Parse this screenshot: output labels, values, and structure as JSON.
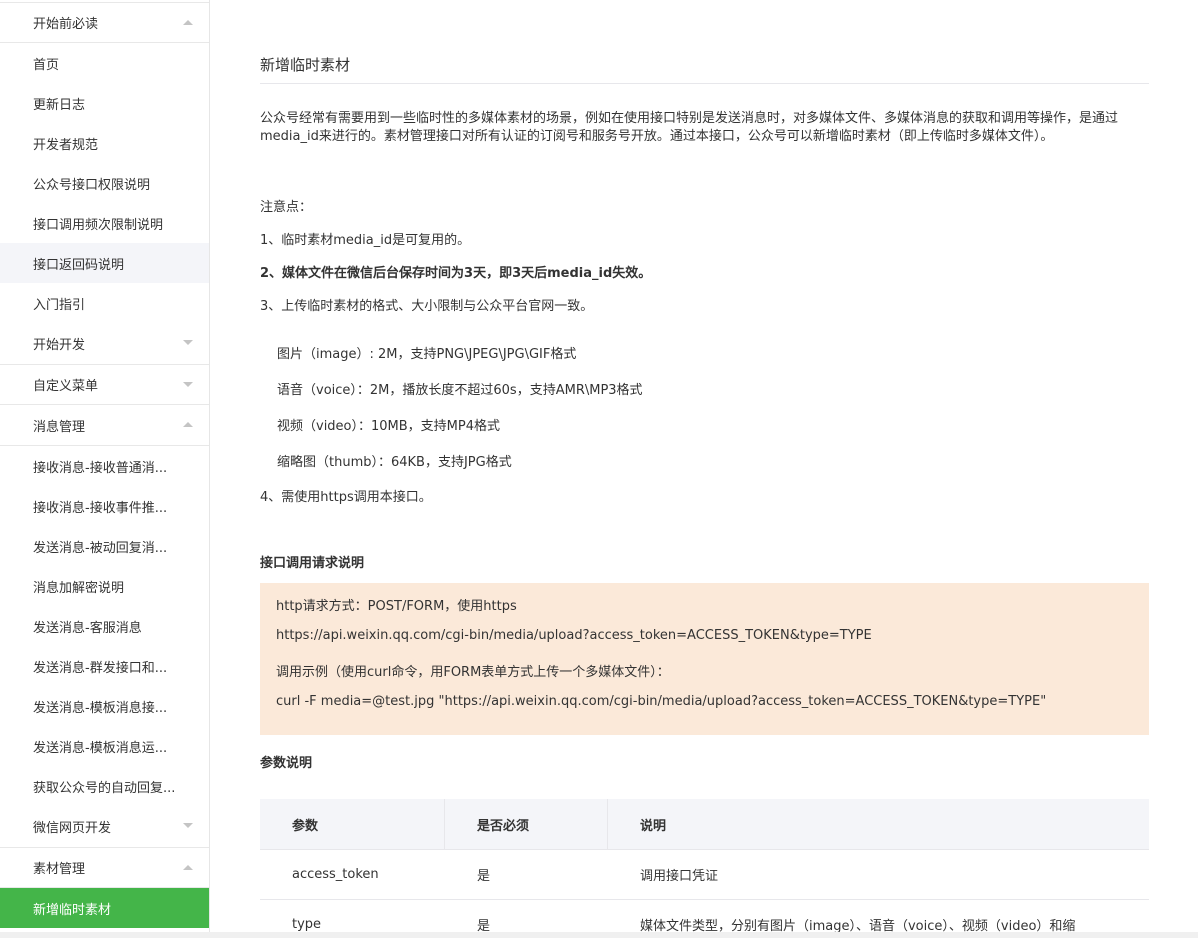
{
  "sidebar": {
    "items": [
      {
        "label": "开始前必读",
        "type": "group",
        "caret": "up"
      },
      {
        "label": "首页"
      },
      {
        "label": "更新日志"
      },
      {
        "label": "开发者规范"
      },
      {
        "label": "公众号接口权限说明"
      },
      {
        "label": "接口调用频次限制说明"
      },
      {
        "label": "接口返回码说明",
        "state": "hover"
      },
      {
        "label": "入门指引"
      },
      {
        "label": "开始开发",
        "caret": "down"
      },
      {
        "label": "自定义菜单",
        "type": "group",
        "caret": "down"
      },
      {
        "label": "消息管理",
        "type": "group",
        "caret": "up"
      },
      {
        "label": "接收消息-接收普通消..."
      },
      {
        "label": "接收消息-接收事件推..."
      },
      {
        "label": "发送消息-被动回复消..."
      },
      {
        "label": "消息加解密说明"
      },
      {
        "label": "发送消息-客服消息"
      },
      {
        "label": "发送消息-群发接口和..."
      },
      {
        "label": "发送消息-模板消息接..."
      },
      {
        "label": "发送消息-模板消息运..."
      },
      {
        "label": "获取公众号的自动回复..."
      },
      {
        "label": "微信网页开发",
        "caret": "down"
      },
      {
        "label": "素材管理",
        "type": "group",
        "caret": "up"
      },
      {
        "label": "新增临时素材",
        "state": "active"
      }
    ]
  },
  "main": {
    "title": "新增临时素材",
    "intro": "公众号经常有需要用到一些临时性的多媒体素材的场景，例如在使用接口特别是发送消息时，对多媒体文件、多媒体消息的获取和调用等操作，是通过media_id来进行的。素材管理接口对所有认证的订阅号和服务号开放。通过本接口，公众号可以新增临时素材（即上传临时多媒体文件）。",
    "notes_title": "注意点：",
    "note1": "1、临时素材media_id是可复用的。",
    "note2": "2、媒体文件在微信后台保存时间为3天，即3天后media_id失效。",
    "note3": "3、上传临时素材的格式、大小限制与公众平台官网一致。",
    "formats": [
      "图片（image）: 2M，支持PNG\\JPEG\\JPG\\GIF格式",
      "语音（voice）：2M，播放长度不超过60s，支持AMR\\MP3格式",
      "视频（video）：10MB，支持MP4格式",
      "缩略图（thumb）：64KB，支持JPG格式"
    ],
    "note4": "4、需使用https调用本接口。",
    "request_title": "接口调用请求说明",
    "code_lines": [
      "http请求方式：POST/FORM，使用https",
      "https://api.weixin.qq.com/cgi-bin/media/upload?access_token=ACCESS_TOKEN&type=TYPE",
      "调用示例（使用curl命令，用FORM表单方式上传一个多媒体文件）：",
      "curl -F media=@test.jpg \"https://api.weixin.qq.com/cgi-bin/media/upload?access_token=ACCESS_TOKEN&type=TYPE\""
    ],
    "params_title": "参数说明",
    "table": {
      "headers": [
        "参数",
        "是否必须",
        "说明"
      ],
      "rows": [
        [
          "access_token",
          "是",
          "调用接口凭证"
        ],
        [
          "type",
          "是",
          "媒体文件类型，分别有图片（image）、语音（voice）、视频（video）和缩"
        ]
      ]
    }
  },
  "colors": {
    "accent": "#44b549",
    "code_bg": "#fbe9d9",
    "table_head_bg": "#f4f5f9"
  }
}
